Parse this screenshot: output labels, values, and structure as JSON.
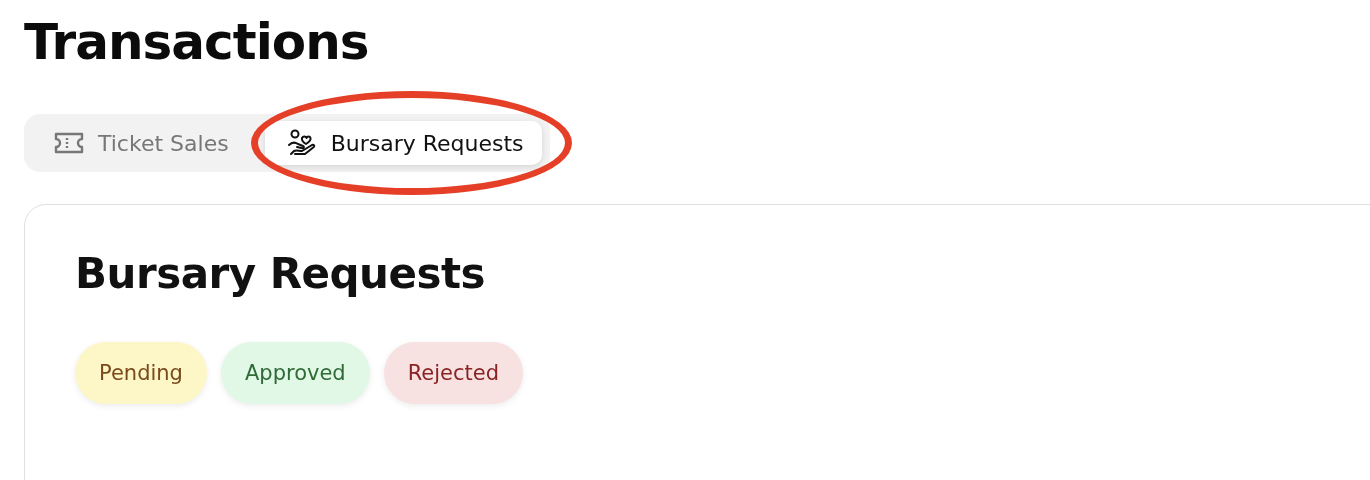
{
  "page_title": "Transactions",
  "tabs": [
    {
      "label": "Ticket Sales",
      "kind": "ticket",
      "selected": false,
      "highlighted": false
    },
    {
      "label": "Bursary Requests",
      "kind": "bursary",
      "selected": true,
      "highlighted": true
    }
  ],
  "card": {
    "title": "Bursary Requests",
    "filters": [
      {
        "label": "Pending",
        "kind": "pending"
      },
      {
        "label": "Approved",
        "kind": "approved"
      },
      {
        "label": "Rejected",
        "kind": "rejected"
      }
    ]
  }
}
